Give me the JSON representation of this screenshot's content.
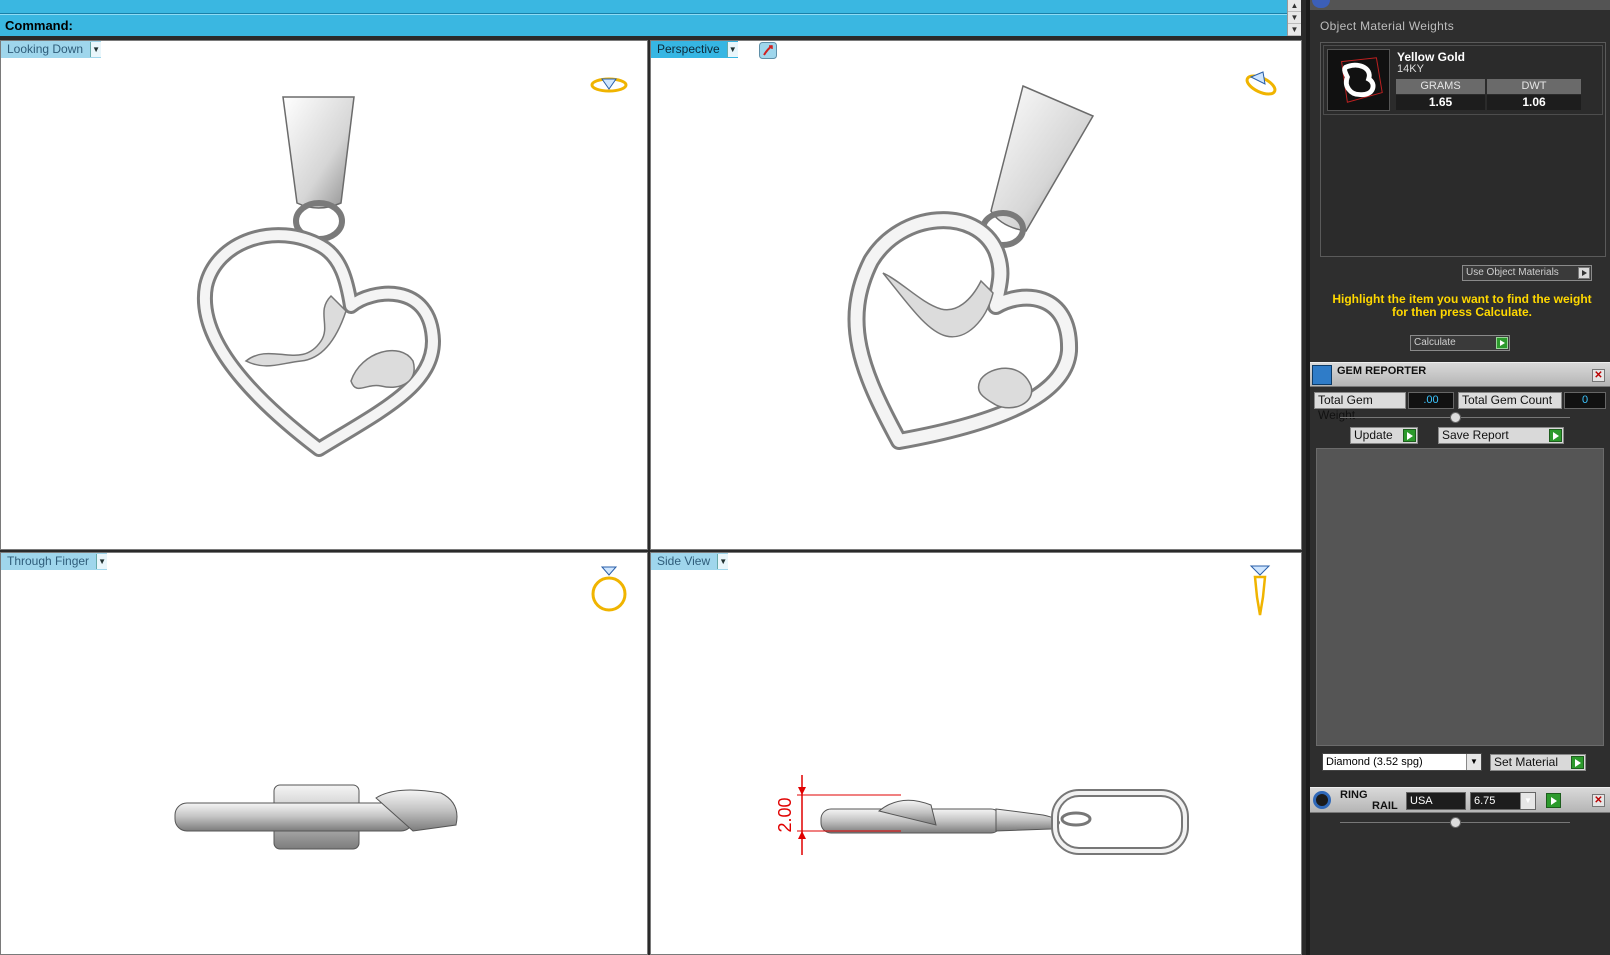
{
  "command": {
    "label": "Command:"
  },
  "viewports": [
    {
      "label": "Looking Down"
    },
    {
      "label": "Perspective"
    },
    {
      "label": "Through Finger"
    },
    {
      "label": "Side View"
    }
  ],
  "side_dimension": "2.00",
  "material_weights": {
    "title": "Object Material Weights",
    "material_name": "Yellow Gold",
    "karat": "14KY",
    "col_grams": "GRAMS",
    "col_dwt": "DWT",
    "grams": "1.65",
    "dwt": "1.06",
    "use_object_materials": "Use Object Materials",
    "hint": "Highlight the item you want to find the weight for then press Calculate.",
    "calculate": "Calculate"
  },
  "gem_reporter": {
    "title": "GEM REPORTER",
    "total_weight_label": "Total Gem Weight",
    "total_weight_value": ".00",
    "total_count_label": "Total Gem Count",
    "total_count_value": "0",
    "update": "Update",
    "save_report": "Save Report",
    "material_select": "Diamond     (3.52 spg)",
    "set_material": "Set Material"
  },
  "ring_rail": {
    "title_1": "RING",
    "title_2": "RAIL",
    "standard": "USA",
    "size": "6.75"
  },
  "colors": {
    "command_bar": "#3ab7e1",
    "viewport_tab": "#9fd6ec",
    "hint_text": "#ffd800",
    "gem_value": "#3cc6ff",
    "dimension": "#e00000"
  }
}
